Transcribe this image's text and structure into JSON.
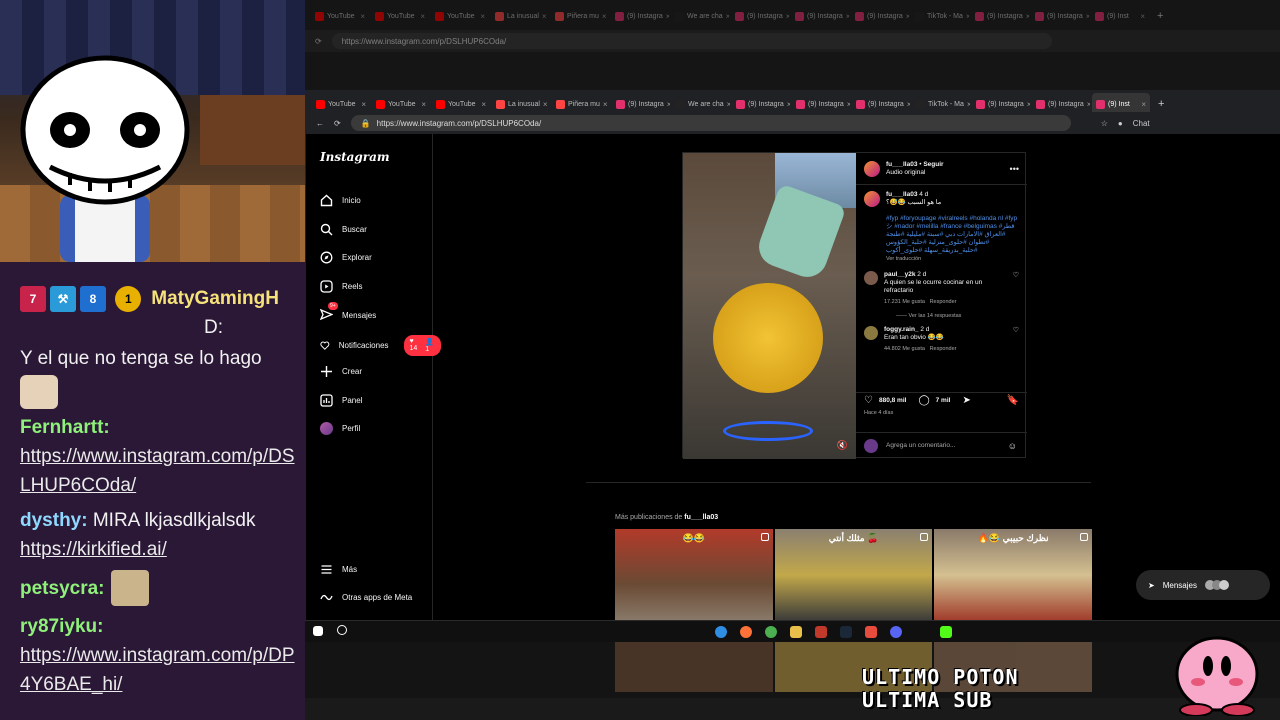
{
  "stream": {
    "overlay_line1": "ULTIMO POTON",
    "overlay_line2": "ULTIMA SUB"
  },
  "chat": {
    "messages": [
      {
        "user": "MatyGamingH",
        "text": "D:",
        "color": "#f6e27a"
      },
      {
        "user": "",
        "text": "Y el que no tenga se lo hago",
        "color": "#f1f1f1"
      },
      {
        "user": "Fernhartt:",
        "link": "https://www.instagram.com/p/DSLHUP6COda/",
        "color": "#8ff07a"
      },
      {
        "user": "dysthy:",
        "text": "MIRA lkjasdlkjalsdk",
        "link": "https://kirkified.ai/",
        "color": "#8fd8ff"
      },
      {
        "user": "petsycra:",
        "color": "#8ff07a"
      },
      {
        "user": "ry87iyku:",
        "link": "https://www.instagram.com/p/DP4Y6BAE_hi/",
        "color": "#8ff07a"
      }
    ],
    "badge_number": "1"
  },
  "browser": {
    "tabs": [
      {
        "label": "YouTube",
        "fav": "#ff0000"
      },
      {
        "label": "YouTube",
        "fav": "#ff0000"
      },
      {
        "label": "YouTube",
        "fav": "#ff0000"
      },
      {
        "label": "La inusual",
        "fav": "#ff4444"
      },
      {
        "label": "Piñera mu",
        "fav": "#ff4444"
      },
      {
        "label": "(9) Instagra",
        "fav": "#e1306c"
      },
      {
        "label": "We are cha",
        "fav": "#222222"
      },
      {
        "label": "(9) Instagra",
        "fav": "#e1306c"
      },
      {
        "label": "(9) Instagra",
        "fav": "#e1306c"
      },
      {
        "label": "(9) Instagra",
        "fav": "#e1306c"
      },
      {
        "label": "TikTok - Ma",
        "fav": "#222222"
      },
      {
        "label": "(9) Instagra",
        "fav": "#e1306c"
      },
      {
        "label": "(9) Instagra",
        "fav": "#e1306c"
      },
      {
        "label": "(9) Inst",
        "fav": "#e1306c"
      }
    ],
    "url": "https://www.instagram.com/p/DSLHUP6COda/",
    "chat_label": "Chat"
  },
  "instagram": {
    "logo": "Instagram",
    "nav": [
      {
        "label": "Inicio",
        "icon": "home-icon"
      },
      {
        "label": "Buscar",
        "icon": "search-icon"
      },
      {
        "label": "Explorar",
        "icon": "compass-icon"
      },
      {
        "label": "Reels",
        "icon": "reels-icon"
      },
      {
        "label": "Mensajes",
        "icon": "messenger-icon"
      },
      {
        "label": "Notificaciones",
        "icon": "heart-icon"
      },
      {
        "label": "Crear",
        "icon": "plus-icon"
      },
      {
        "label": "Panel",
        "icon": "chart-icon"
      },
      {
        "label": "Perfil",
        "icon": "avatar-icon"
      }
    ],
    "nav_more": "Más",
    "nav_meta": "Otras apps de Meta",
    "notif_likes": "14",
    "notif_follows": "1",
    "messages_badge": "9+",
    "post": {
      "author": "fu___lla03",
      "follow": "Seguir",
      "audio": "Audio original",
      "caption_user": "fu___lla03",
      "caption_age": "4 d",
      "caption_text": "ما هو السبب 😂😅؟",
      "hashtags": "#fyp #foryoupage #viralreels #holanda nl #fyp シ #nador #melilla #france #belguimas #قطر #العراق #الامارات دبي #سبتة #مليلية #طنجة #تطوان #حلوى_منزلية #حلبة_الكؤوس #حلبة_بدريقة_سهلة #حلوى_أكوب",
      "see_translation": "Ver traducción",
      "comments": [
        {
          "user": "paul__y2k",
          "age": "2 d",
          "text": "A quien se le ocurre cocinar en un refractario",
          "likes": "17.231 Me gusta",
          "reply": "Responder",
          "thread": "Ver las 14 respuestas"
        },
        {
          "user": "foggy.rain_",
          "age": "2 d",
          "text": "Eran tan obvio 😂😂",
          "likes": "44.802 Me gusta",
          "reply": "Responder"
        }
      ],
      "likes_count": "880,8 mil",
      "comments_count": "7 mil",
      "posted": "Hace 4 días",
      "add_comment": "Agrega un comentario..."
    },
    "more_from_prefix": "Más publicaciones de",
    "more_from_user": "fu___lla03",
    "thumbs": [
      {
        "caption": "😂😂"
      },
      {
        "caption": "مثلك أنتي 🍒"
      },
      {
        "caption": "🔥😂 نظرك حبيبي"
      }
    ],
    "messages_float": "Mensajes"
  }
}
